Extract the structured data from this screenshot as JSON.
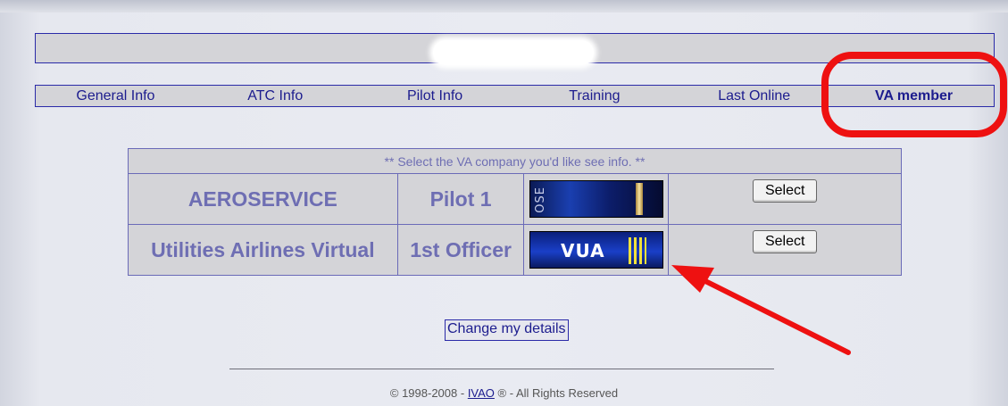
{
  "nav": {
    "items": [
      {
        "label": "General Info"
      },
      {
        "label": "ATC Info"
      },
      {
        "label": "Pilot Info"
      },
      {
        "label": "Training"
      },
      {
        "label": "Last Online"
      },
      {
        "label": "VA member"
      }
    ],
    "active": "VA member"
  },
  "va_table": {
    "header": "** Select the VA company you'd like see info. **",
    "rows": [
      {
        "company": "AEROSERVICE",
        "rank": "Pilot 1",
        "logo_text": "OSE",
        "button": "Select"
      },
      {
        "company": "Utilities Airlines Virtual",
        "rank": "1st Officer",
        "logo_text": "VUA",
        "button": "Select"
      }
    ]
  },
  "change_details": "Change my details",
  "footer": {
    "prefix": "© 1998-2008 - ",
    "link": "IVAO",
    "suffix": " ® - All Rights Reserved"
  },
  "colors": {
    "accent": "#1c1c8e",
    "table_text": "#6e6eb3",
    "annotation": "#ee1111"
  }
}
